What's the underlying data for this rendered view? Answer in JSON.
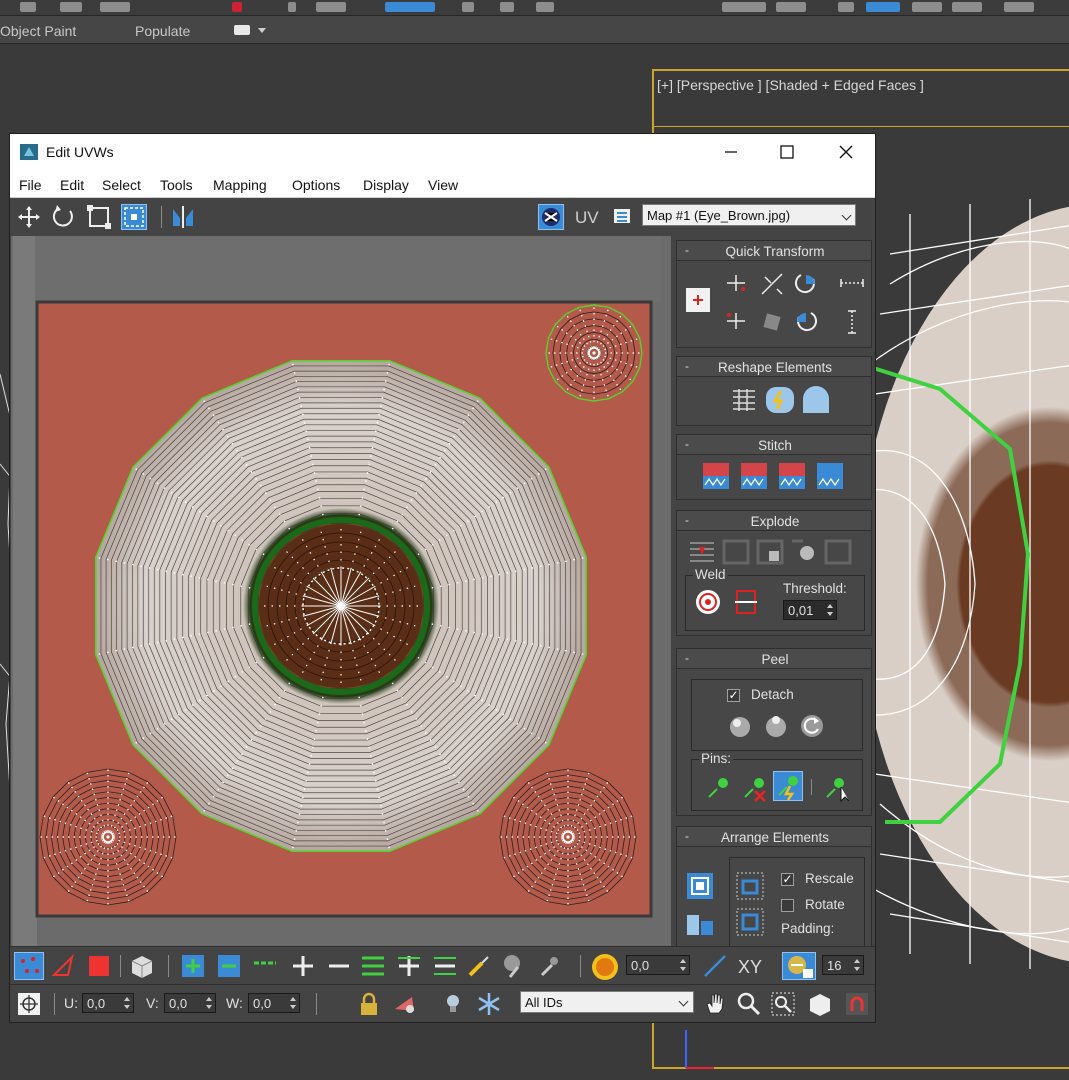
{
  "app": {
    "ribbon_tabs": [
      "Object Paint",
      "Populate"
    ],
    "viewport_label": "[+] [Perspective ] [Shaded + Edged Faces ]"
  },
  "window": {
    "title": "Edit UVWs",
    "menu": [
      "File",
      "Edit",
      "Select",
      "Tools",
      "Mapping",
      "Options",
      "Display",
      "View"
    ],
    "uv_label": "UV",
    "map_selected": "Map #1 (Eye_Brown.jpg)"
  },
  "rollouts": {
    "quick_transform": "Quick Transform",
    "reshape_elements": "Reshape Elements",
    "stitch": "Stitch",
    "explode": "Explode",
    "weld": "Weld",
    "threshold_label": "Threshold:",
    "threshold_value": "0,01",
    "peel": "Peel",
    "detach_label": "Detach",
    "detach_checked": true,
    "pins_label": "Pins:",
    "arrange_elements": "Arrange Elements",
    "rescale_label": "Rescale",
    "rescale_checked": true,
    "rotate_label": "Rotate",
    "rotate_checked": false,
    "padding_label": "Padding:"
  },
  "bottom": {
    "soft_value": "0,0",
    "xy_label": "XY",
    "grid_value": "16",
    "u_label": "U:",
    "u_value": "0,0",
    "v_label": "V:",
    "v_value": "0,0",
    "w_label": "W:",
    "w_value": "0,0",
    "ids_selected": "All IDs"
  },
  "colors": {
    "accent_blue": "#3a8ad6",
    "uv_bg": "#b35a4a",
    "edge_green": "#3fd13f",
    "viewport_frame": "#c9a62b"
  }
}
